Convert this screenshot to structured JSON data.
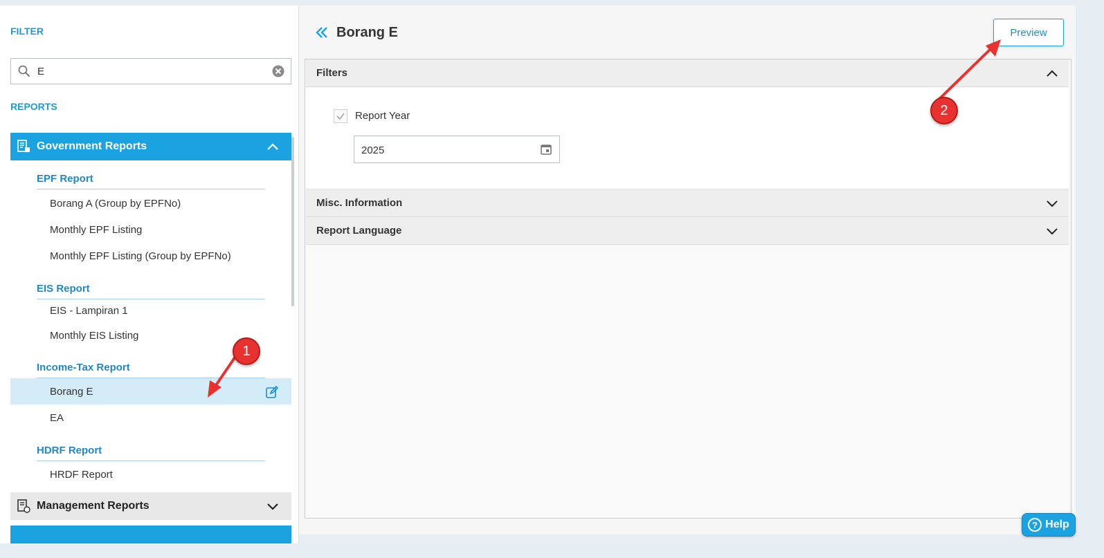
{
  "sidebar": {
    "filter_label": "FILTER",
    "search": {
      "value": "E",
      "placeholder": ""
    },
    "reports_label": "REPORTS",
    "groups": [
      {
        "label": "Government Reports",
        "expanded": true,
        "categories": [
          {
            "title": "EPF Report",
            "items": [
              "Borang A (Group by EPFNo)",
              "Monthly EPF Listing",
              "Monthly EPF Listing (Group by EPFNo)"
            ]
          },
          {
            "title": "EIS Report",
            "items": [
              "EIS - Lampiran 1",
              "Monthly EIS Listing"
            ]
          },
          {
            "title": "Income-Tax Report",
            "items": [
              "Borang E",
              "EA"
            ]
          },
          {
            "title": "HDRF Report",
            "items": [
              "HRDF Report"
            ]
          }
        ]
      },
      {
        "label": "Management Reports",
        "expanded": false
      }
    ],
    "selected_item": "Borang E"
  },
  "main": {
    "title": "Borang E",
    "preview_label": "Preview",
    "sections": {
      "filters": {
        "label": "Filters",
        "expanded": true
      },
      "misc": {
        "label": "Misc. Information",
        "expanded": false
      },
      "language": {
        "label": "Report Language",
        "expanded": false
      }
    },
    "report_year": {
      "label": "Report Year",
      "checked": true,
      "value": "2025"
    }
  },
  "annotations": {
    "badge1": "1",
    "badge2": "2"
  },
  "help_label": "Help",
  "colors": {
    "accent": "#1aa3e0",
    "link": "#1e88c8",
    "selected_row": "#d3ecf8",
    "annotation": "#e8322f"
  }
}
